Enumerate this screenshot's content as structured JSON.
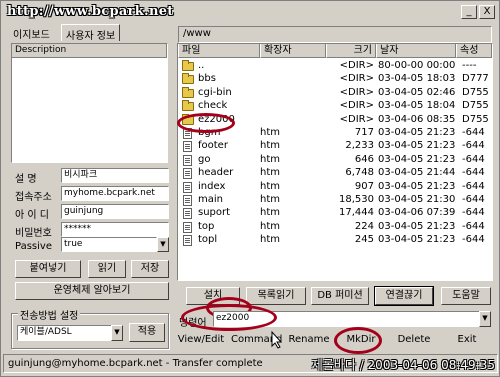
{
  "window": {
    "title": "http://www.bcpark.net"
  },
  "titlebar_buttons": {
    "minimize": "_",
    "close": "X"
  },
  "left_tabs": [
    "이지보드",
    "사용자 정보"
  ],
  "left": {
    "description_header": "Description",
    "fields": [
      {
        "label": "설    명",
        "value": "비시파크"
      },
      {
        "label": "접속주소",
        "value": "myhome.bcpark.net"
      },
      {
        "label": "아 이 디",
        "value": "guinjung"
      },
      {
        "label": "비밀번호",
        "value": "******"
      },
      {
        "label": "Passive",
        "value": "true"
      }
    ],
    "buttons": {
      "paste": "붙여넣기",
      "read": "읽기",
      "save": "저장"
    },
    "os_button": "운영체제 알아보기",
    "transfer_group_label": "전송방법 설정",
    "transfer_value": "케이블/ADSL",
    "apply": "적용"
  },
  "right": {
    "path": "/www",
    "columns": [
      "파일",
      "확장자",
      "크기",
      "날자",
      "속성"
    ],
    "rows": [
      {
        "name": "..",
        "ext": "",
        "size": "<DIR>",
        "date": "80-00-00 00:00",
        "attr": "----",
        "type": "folder"
      },
      {
        "name": "bbs",
        "ext": "",
        "size": "<DIR>",
        "date": "03-04-05 18:03",
        "attr": "D777",
        "type": "folder"
      },
      {
        "name": "cgi-bin",
        "ext": "",
        "size": "<DIR>",
        "date": "03-04-05 02:46",
        "attr": "D755",
        "type": "folder"
      },
      {
        "name": "check",
        "ext": "",
        "size": "<DIR>",
        "date": "03-04-05 18:04",
        "attr": "D755",
        "type": "folder"
      },
      {
        "name": "ez2000",
        "ext": "",
        "size": "<DIR>",
        "date": "03-04-06 08:35",
        "attr": "D755",
        "type": "folder"
      },
      {
        "name": "bgm",
        "ext": "htm",
        "size": "717",
        "date": "03-04-05 21:23",
        "attr": "-644",
        "type": "file"
      },
      {
        "name": "footer",
        "ext": "htm",
        "size": "2,233",
        "date": "03-04-05 21:23",
        "attr": "-644",
        "type": "file"
      },
      {
        "name": "go",
        "ext": "htm",
        "size": "646",
        "date": "03-04-05 21:23",
        "attr": "-644",
        "type": "file"
      },
      {
        "name": "header",
        "ext": "htm",
        "size": "6,748",
        "date": "03-04-05 21:44",
        "attr": "-644",
        "type": "file"
      },
      {
        "name": "index",
        "ext": "htm",
        "size": "907",
        "date": "03-04-05 21:23",
        "attr": "-644",
        "type": "file"
      },
      {
        "name": "main",
        "ext": "htm",
        "size": "18,530",
        "date": "03-04-05 21:30",
        "attr": "-644",
        "type": "file"
      },
      {
        "name": "suport",
        "ext": "htm",
        "size": "17,444",
        "date": "03-04-06 07:39",
        "attr": "-644",
        "type": "file"
      },
      {
        "name": "top",
        "ext": "htm",
        "size": "224",
        "date": "03-04-05 21:23",
        "attr": "-644",
        "type": "file"
      },
      {
        "name": "topl",
        "ext": "htm",
        "size": "245",
        "date": "03-04-05 21:23",
        "attr": "-644",
        "type": "file"
      }
    ],
    "buttons": [
      "설치",
      "목록읽기",
      "DB 퍼미션",
      "연결끊기",
      "도움말"
    ],
    "command_label": "명령어",
    "command_value": "ez2000",
    "bottom_tabs": [
      "View/Edit",
      "Command",
      "Rename",
      "MkDir",
      "Delete",
      "Exit"
    ]
  },
  "status": "guinjung@myhome.bcpark.net - Transfer complete",
  "watermark": "제롤바다 / 2003-04-06 08:49:35",
  "colors": {
    "highlight_circle": "#a4001a",
    "folder": "#e8c84a"
  }
}
